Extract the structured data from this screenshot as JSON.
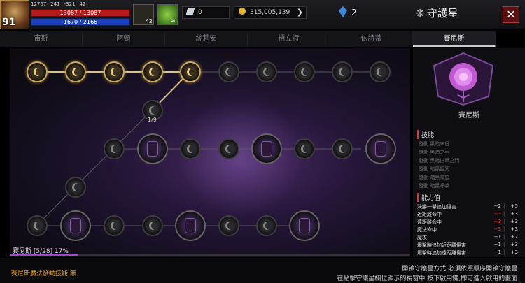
{
  "player": {
    "level": "91",
    "combat_power": "12767",
    "stat_a": "241",
    "stat_b": "-321",
    "stat_c": "42",
    "hp_text": "13087 / 13087",
    "mp_text": "1670 / 2166"
  },
  "buffs": [
    {
      "icon": "gear-potion-icon",
      "count": "42"
    },
    {
      "icon": "leaf-icon",
      "count": "∞"
    }
  ],
  "currency": {
    "diamond_value": "0",
    "gold_value": "315,005,139",
    "crystal_value": "2"
  },
  "panel_title": "守護星",
  "close_label": "✕",
  "tabs": [
    "宙斯",
    "阿頓",
    "絲莉安",
    "梧立特",
    "依詩蒂",
    "賽尼斯"
  ],
  "active_tab": "賽尼斯",
  "help_label": "?",
  "constellation": {
    "node_label": "1/9",
    "progress_text": "賽尼斯 [5/28] 17%",
    "progress_fraction": 0.17
  },
  "side": {
    "name": "賽尼斯",
    "skills_title": "技能",
    "skills": [
      "發動 黑暗末日",
      "發動 黑暗之手",
      "發動 黑暗出擊之門",
      "發動 暗黑詛咒",
      "發動 暗黑障壁",
      "發動 暗黑呼喚"
    ],
    "attrs_title": "能力值",
    "attrs": [
      {
        "name": "決勝一擊追加傷害",
        "v1": "+2",
        "v2": "+5",
        "v1_red": false
      },
      {
        "name": "近距離命中",
        "v1": "+3",
        "v2": "+3",
        "v1_red": true
      },
      {
        "name": "遠距離命中",
        "v1": "+3",
        "v2": "+3",
        "v1_red": true
      },
      {
        "name": "魔法命中",
        "v1": "+3",
        "v2": "+3",
        "v1_red": true
      },
      {
        "name": "魔攻",
        "v1": "+1",
        "v2": "+2",
        "v1_red": false
      },
      {
        "name": "爆擊時追加近距離傷害",
        "v1": "+1",
        "v2": "+3",
        "v1_red": false
      },
      {
        "name": "爆擊時追加遠距離傷害",
        "v1": "+1",
        "v2": "+3",
        "v1_red": false
      }
    ]
  },
  "footer": {
    "magic_text": "賽尼斯魔法發動技能:無",
    "info_line1": "開啟守護星方式,必須依照順序開啟守護星.",
    "info_line2": "在點擊守護星欄位顯示的視窗中,按下啟用鍵,即可進入啟用的畫面."
  },
  "colors": {
    "active_node": "#c9a85a",
    "progress": "#9a4ac8",
    "red_value": "#e04545"
  }
}
